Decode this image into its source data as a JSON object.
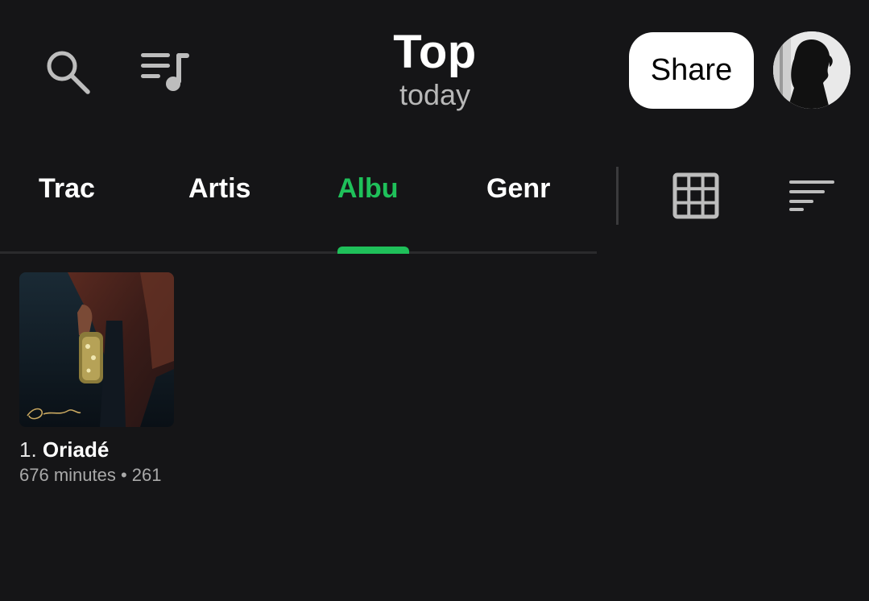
{
  "header": {
    "title": "Top",
    "subtitle": "today",
    "share_label": "Share"
  },
  "icons": {
    "search": "search-icon",
    "queue": "queue-music-icon",
    "grid": "grid-view-icon",
    "sort": "sort-icon"
  },
  "tabs": [
    {
      "label": "Trac",
      "active": false
    },
    {
      "label": "Artis",
      "active": false
    },
    {
      "label": "Albu",
      "active": true
    },
    {
      "label": "Genr",
      "active": false
    }
  ],
  "albums": [
    {
      "rank": "1.",
      "title": "Oriadé",
      "meta": "676 minutes • 261",
      "cover_script": "Oriadé"
    }
  ],
  "colors": {
    "background": "#151517",
    "accent": "#1fc05a",
    "muted_text": "#a9a9a9"
  }
}
